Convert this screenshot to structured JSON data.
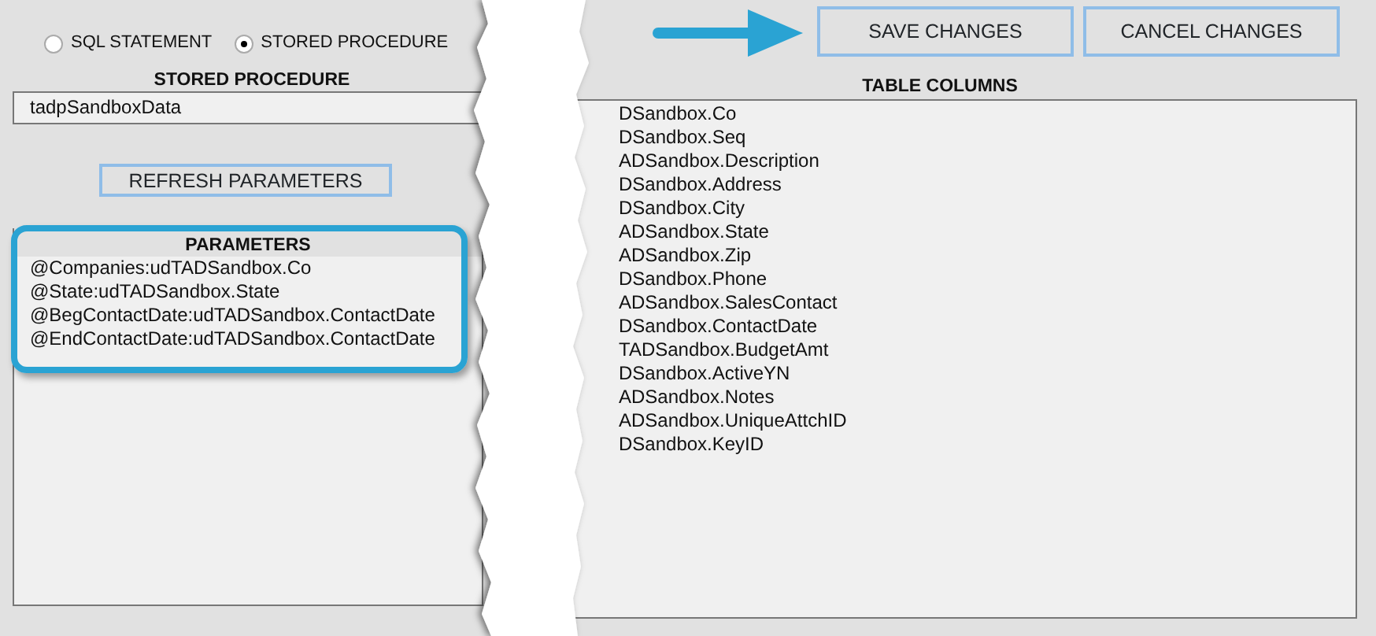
{
  "source_options": [
    {
      "label": "SQL STATEMENT",
      "selected": false
    },
    {
      "label": "STORED PROCEDURE",
      "selected": true
    }
  ],
  "stored_procedure": {
    "heading": "STORED PROCEDURE",
    "value": "tadpSandboxData"
  },
  "refresh_button": "REFRESH PARAMETERS",
  "parameters": {
    "heading": "PARAMETERS",
    "highlighted": true,
    "items": [
      "@Companies:udTADSandbox.Co",
      "@State:udTADSandbox.State",
      "@BegContactDate:udTADSandbox.ContactDate",
      "@EndContactDate:udTADSandbox.ContactDate"
    ]
  },
  "buttons": [
    "SAVE CHANGES",
    "CANCEL CHANGES"
  ],
  "table_columns": {
    "heading": "TABLE COLUMNS",
    "items": [
      "DSandbox.Co",
      "DSandbox.Seq",
      "ADSandbox.Description",
      "DSandbox.Address",
      "DSandbox.City",
      "ADSandbox.State",
      "ADSandbox.Zip",
      "DSandbox.Phone",
      "ADSandbox.SalesContact",
      "DSandbox.ContactDate",
      "TADSandbox.BudgetAmt",
      "DSandbox.ActiveYN",
      "ADSandbox.Notes",
      "ADSandbox.UniqueAttchID",
      "DSandbox.KeyID"
    ]
  }
}
